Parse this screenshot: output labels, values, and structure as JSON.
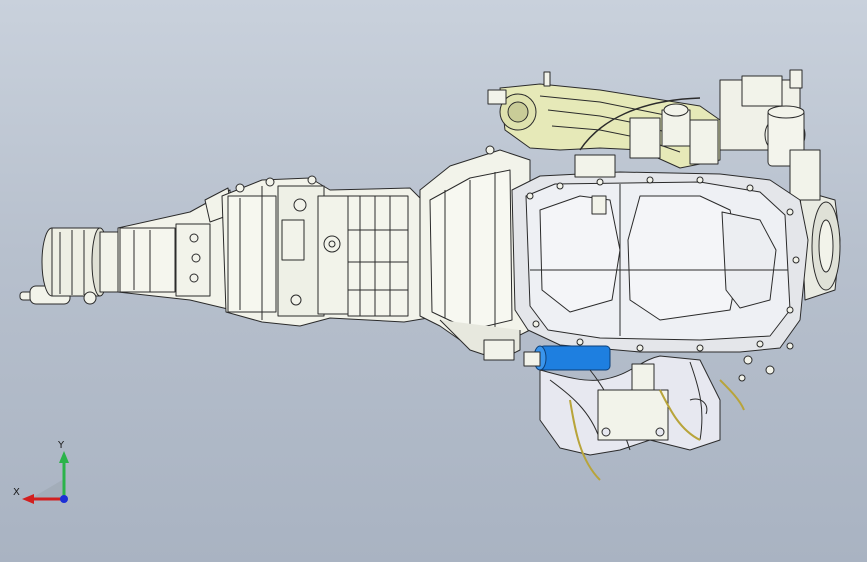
{
  "viewport": {
    "background_top": "#c9d1dc",
    "background_bottom": "#a9b3c2"
  },
  "model": {
    "description_icon": "engine-transmission-assembly",
    "colors": {
      "body": "#f2f3ea",
      "edge": "#2b2b2b",
      "manifold": "#e6e9b8",
      "starter": "#1e7fe0",
      "oil_pan": "#eef0f4",
      "harness": "#f0f08a"
    }
  },
  "triad": {
    "x_label": "X",
    "y_label": "Y",
    "x_color": "#d21f1f",
    "y_color": "#2bb34a",
    "z_color": "#1c2fd6"
  }
}
